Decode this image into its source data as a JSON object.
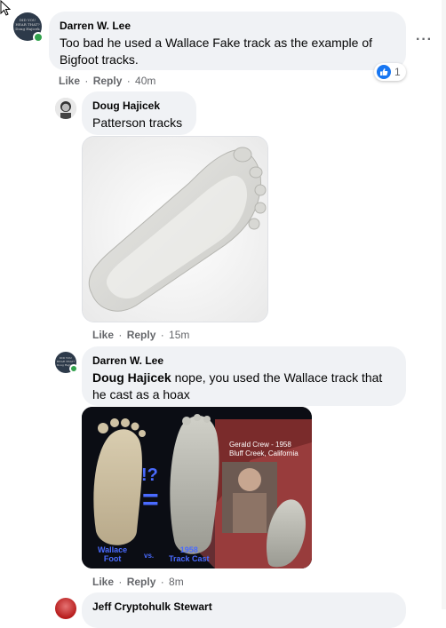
{
  "comments": [
    {
      "author": "Darren W. Lee",
      "text": "Too bad he used a Wallace Fake track as the example of Bigfoot tracks.",
      "like": "Like",
      "reply": "Reply",
      "time": "40m",
      "reactions": "1",
      "avatar_text": "DID YOU HEAR THAT? Doug Hajicek"
    },
    {
      "author": "Doug Hajicek",
      "text": "Patterson tracks",
      "like": "Like",
      "reply": "Reply",
      "time": "15m"
    },
    {
      "author": "Darren W. Lee",
      "mention": "Doug Hajicek",
      "text": " nope, you used the Wallace track that he cast as a hoax",
      "like": "Like",
      "reply": "Reply",
      "time": "8m",
      "avatar_text": "DID YOU HEAR THAT? Doug Hajicek"
    },
    {
      "author": "Jeff Cryptohulk Stewart"
    }
  ],
  "image2": {
    "excl": "!?",
    "eq": "=",
    "caption_right": "Gerald Crew - 1958\nBluff Creek, California",
    "label_left": "Wallace\nFoot",
    "vs": "vs.",
    "label_mid": "1958\nTrack Cast"
  },
  "separator": " · ",
  "more_glyph": "···",
  "colors": {
    "bubble": "#f0f2f5",
    "link": "#65676b",
    "like_blue": "#1877f2",
    "online": "#31a24c",
    "photo_bg": "#0b0d14",
    "caption_blue": "#4a6bff"
  }
}
